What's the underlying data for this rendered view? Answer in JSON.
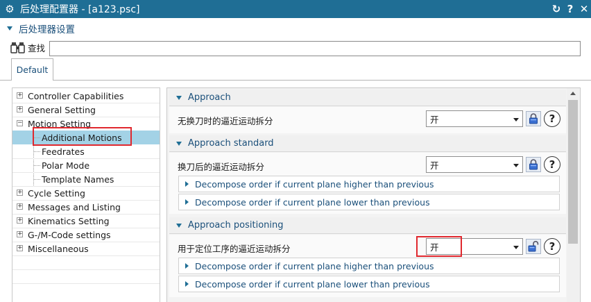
{
  "window": {
    "title": "后处理配置器 - [a123.psc]",
    "controls": {
      "refresh": "↻",
      "help": "?",
      "close": "✕"
    }
  },
  "section": {
    "title": "后处理器设置"
  },
  "search": {
    "label": "查找",
    "value": "",
    "placeholder": ""
  },
  "tabs": [
    {
      "label": "Default",
      "active": true
    }
  ],
  "tree": {
    "items": [
      {
        "label": "Controller Capabilities",
        "expand": "+"
      },
      {
        "label": "General Setting",
        "expand": "+"
      },
      {
        "label": "Motion Setting",
        "expand": "−"
      },
      {
        "label": "Additional Motions",
        "selected": true
      },
      {
        "label": "Feedrates"
      },
      {
        "label": "Polar Mode"
      },
      {
        "label": "Template Names"
      },
      {
        "label": "Cycle Setting",
        "expand": "+"
      },
      {
        "label": "Messages and Listing",
        "expand": "+"
      },
      {
        "label": "Kinematics Setting",
        "expand": "+"
      },
      {
        "label": "G-/M-Code settings",
        "expand": "+"
      },
      {
        "label": "Miscellaneous",
        "expand": "+"
      }
    ]
  },
  "groups": [
    {
      "title": "Approach",
      "setting_label": "无换刀时的逼近运动拆分",
      "value": "开",
      "locked": true,
      "subsections": []
    },
    {
      "title": "Approach standard",
      "setting_label": "换刀后的逼近运动拆分",
      "value": "开",
      "locked": true,
      "subsections": [
        "Decompose order if current plane higher than previous",
        "Decompose order if current plane lower than previous"
      ]
    },
    {
      "title": "Approach positioning",
      "setting_label": "用于定位工序的逼近运动拆分",
      "value": "开",
      "locked": false,
      "subsections": [
        "Decompose order if current plane higher than previous",
        "Decompose order if current plane lower than previous"
      ]
    }
  ],
  "colors": {
    "titlebar": "#1f6e95",
    "accent_text": "#1a4f7a",
    "selection": "#a3d2e6",
    "highlight_box": "#e0282e"
  },
  "icons": {
    "gear": "gear-icon",
    "binoculars": "binoculars-icon",
    "lock": "lock-icon",
    "unlock": "unlock-icon",
    "help": "help-icon"
  }
}
